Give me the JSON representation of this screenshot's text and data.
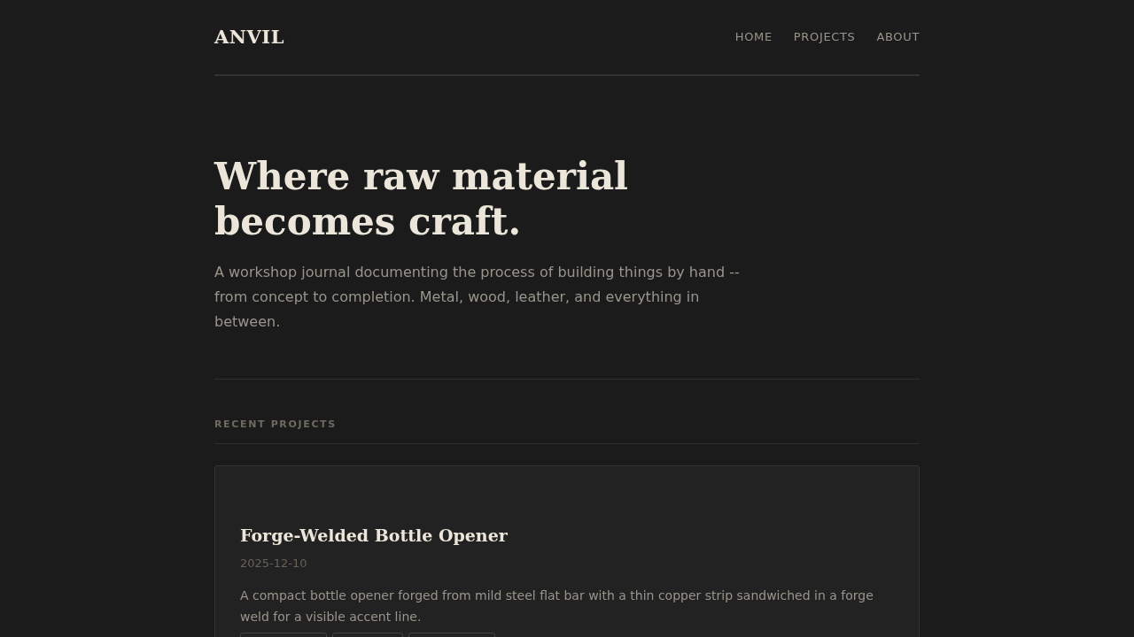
{
  "header": {
    "logo": "ANVIL",
    "nav": [
      {
        "label": "HOME"
      },
      {
        "label": "PROJECTS"
      },
      {
        "label": "ABOUT"
      }
    ]
  },
  "hero": {
    "title_lines": [
      "Where raw material",
      "becomes craft."
    ],
    "intro": "A workshop journal documenting the process of building things by hand -- from concept to completion. Metal, wood, leather, and everything in between."
  },
  "recent": {
    "heading": "RECENT PROJECTS",
    "projects": [
      {
        "title": "Forge-Welded Bottle Opener",
        "date": "2025-12-10",
        "summary": "A compact bottle opener forged from mild steel flat bar with a thin copper strip sandwiched in a forge weld for a visible accent line."
      }
    ]
  }
}
